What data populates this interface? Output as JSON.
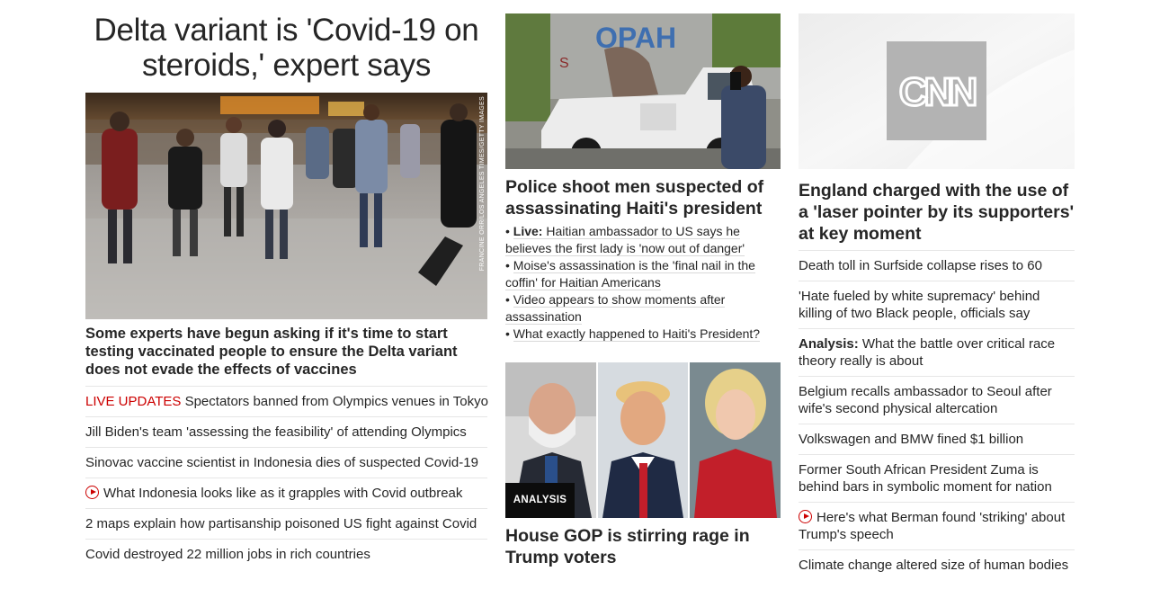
{
  "col1": {
    "headline": "Delta variant is 'Covid-19 on steroids,' expert says",
    "image_credit": "FRANCINE ORR/LOS ANGELES TIMES/GETTY IMAGES",
    "summary": "Some experts have begun asking if it's time to start testing vaccinated people to ensure the Delta variant does not evade the effects of vaccines",
    "links": [
      {
        "prefix": "LIVE UPDATES",
        "text": " Spectators banned from Olympics venues in Tokyo"
      },
      {
        "text": "Jill Biden's team 'assessing the feasibility' of attending Olympics"
      },
      {
        "text": "Sinovac vaccine scientist in Indonesia dies of suspected Covid-19"
      },
      {
        "video": true,
        "icon": "play-icon",
        "text": "What Indonesia looks like as it grapples with Covid outbreak"
      },
      {
        "text": "2 maps explain how partisanship poisoned US fight against Covid"
      },
      {
        "text": "Covid destroyed 22 million jobs in rich countries"
      }
    ]
  },
  "col2": {
    "haiti_mural_text": "OPAH",
    "haiti_headline": "Police shoot men suspected of assassinating Haiti's president",
    "bullets": [
      {
        "prefix": "Live:",
        "text": " Haitian ambassador to US says he believes the first lady is 'now out of danger'"
      },
      {
        "text": "Moise's assassination is the 'final nail in the coffin' for Haitian Americans"
      },
      {
        "text": "Video appears to show moments after assassination"
      },
      {
        "text": "What exactly happened to Haiti's President?"
      }
    ],
    "badge": "ANALYSIS",
    "gop_headline": "House GOP is stirring rage in Trump voters"
  },
  "col3": {
    "logo_text": "CNN",
    "headline": "England charged with the use of a 'laser pointer by its supporters' at key moment",
    "links": [
      {
        "text": "Death toll in Surfside collapse rises to 60"
      },
      {
        "text": "'Hate fueled by white supremacy' behind killing of two Black people, officials say"
      },
      {
        "prefix": "Analysis:",
        "text": " What the battle over critical race theory really is about"
      },
      {
        "text": "Belgium recalls ambassador to Seoul after wife's second physical altercation"
      },
      {
        "text": "Volkswagen and BMW fined $1 billion"
      },
      {
        "text": "Former South African President Zuma is behind bars in symbolic moment for nation"
      },
      {
        "video": true,
        "icon": "play-icon",
        "text": "Here's what Berman found 'striking' about Trump's speech"
      },
      {
        "text": "Climate change altered size of human bodies"
      }
    ]
  },
  "colors": {
    "live_red": "#cc0000",
    "text": "#262626",
    "divider": "#e6e6e6",
    "badge_bg": "#0c0c0c"
  }
}
